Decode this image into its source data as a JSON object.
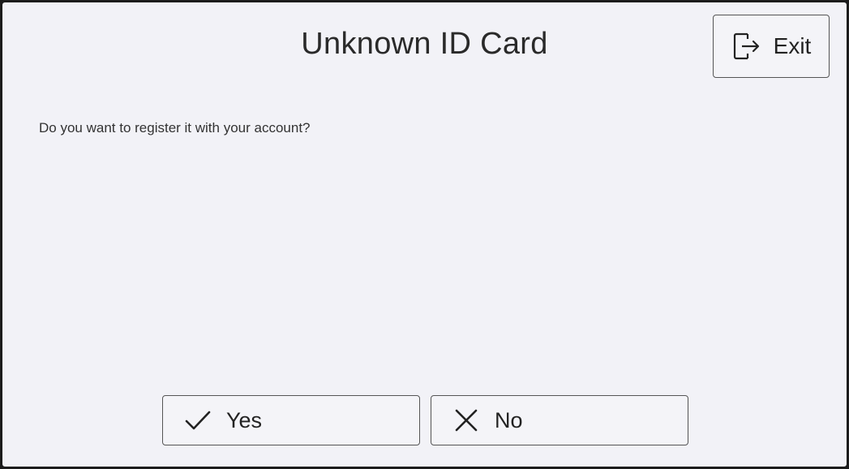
{
  "dialog": {
    "title": "Unknown ID Card",
    "prompt": "Do you want to register it with your account?"
  },
  "exit_button": {
    "label": "Exit",
    "icon": "exit-icon"
  },
  "actions": {
    "yes": {
      "label": "Yes",
      "icon": "checkmark-icon"
    },
    "no": {
      "label": "No",
      "icon": "close-icon"
    }
  },
  "colors": {
    "background": "#f2f2f7",
    "border": "#1c1c1c",
    "text": "#222222"
  }
}
